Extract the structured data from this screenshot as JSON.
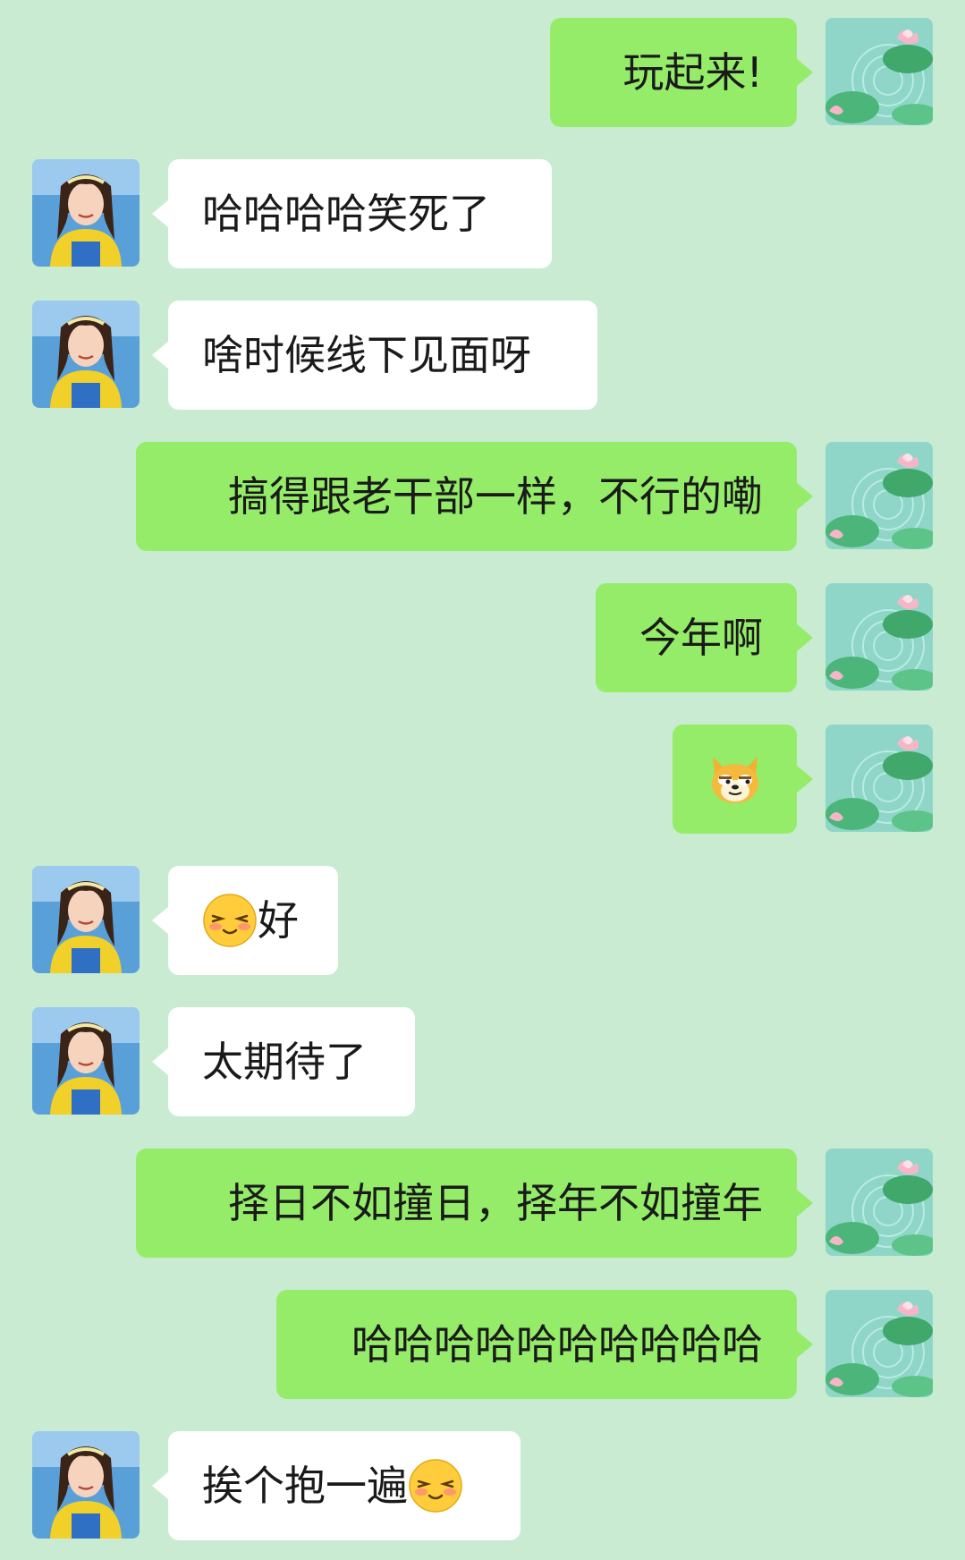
{
  "messages": [
    {
      "side": "right",
      "text": "玩起来!"
    },
    {
      "side": "left",
      "text": "哈哈哈哈笑死了"
    },
    {
      "side": "left",
      "text": "啥时候线下见面呀"
    },
    {
      "side": "right",
      "text": "搞得跟老干部一样，不行的嘞"
    },
    {
      "side": "right",
      "text": "今年啊"
    },
    {
      "side": "right",
      "text": "",
      "emoji": "doge-sticker-icon"
    },
    {
      "side": "left",
      "text": "好",
      "emoji_before": "blushing-smile-emoji-icon"
    },
    {
      "side": "left",
      "text": "太期待了"
    },
    {
      "side": "right",
      "text": "择日不如撞日，择年不如撞年"
    },
    {
      "side": "right",
      "text": "哈哈哈哈哈哈哈哈哈哈"
    },
    {
      "side": "left",
      "text": "挨个抱一遍",
      "emoji_after": "blushing-smile-emoji-icon"
    }
  ],
  "avatars": {
    "self": "lotus-pond-avatar",
    "contact": "girl-photo-avatar"
  },
  "colors": {
    "background": "#c8ebd2",
    "sent_bubble": "#95ec69",
    "received_bubble": "#ffffff"
  }
}
